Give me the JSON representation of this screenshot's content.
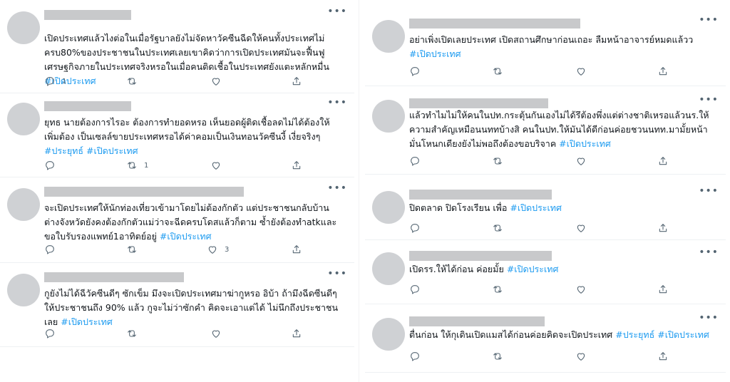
{
  "more_label": "•••",
  "tweets": [
    {
      "body": "เปิดประเทศแล้วไงต่อในเมื่อรัฐบาลยังไม่จัดหาวัคซีนฉีดให้คนทั้งประเทศไม่ครบ80%ของประชาชนในประเทศเลยเขาคิดว่าการเปิดประเทศมันจะฟื้นฟูเศรษฐกิจภายในประเทศจริงหรอในเมื่อคนติดเชื้อในประเทศยังแตะหลักหมื่น",
      "tags": "#เปิดประเทศ",
      "reply": "1",
      "retweet": "",
      "like": ""
    },
    {
      "body": "ยุทธ นายต้องการไรอะ ต้องการทำยอดหรอ  เห็นยอดผู้ติดเชื้อลดไม่ได้ต้องให้เพิ่มต้อง เป็นเซลล์ขายประเทศหรอได้ค่าคอมเป็นเงินทอนวัคซีนงี้ เงี่ยจริงๆ",
      "tags": "#ประยุทธ์ #เปิดประเทศ",
      "reply": "",
      "retweet": "1",
      "like": ""
    },
    {
      "body": "จะเปิดประเทศให้นักท่องเที่ยวเข้ามาโดยไม่ต้องกักตัว แต่ประชาชนกลับบ้านต่างจังหวัดยังคงต้องกักตัวแม่ว่าจะฉีดครบโดสแล้วก็ตาม ซ้ำยังต้องทำatkและขอใบรับรองแพทย์1อาทิตย์อยู่",
      "tags": "#เปิดประเทศ",
      "reply": "",
      "retweet": "",
      "like": "3"
    },
    {
      "body": "กูยังไม่ได้ฉีวัคซีนดีๆ ซักเข็ม มึงจะเปิดประเทศมาฆ่ากูหรอ อิบ้า ถ้ามึงฉีดซีนดีๆ ให้ประชาชนถึง 90% แล้ว กูจะไม่ว่าซักคำ คิดจะเอาแต่ได้ ไม่นึกถึงประชาชนเลย",
      "tags": "#เปิดประเทศ",
      "reply": "",
      "retweet": "",
      "like": ""
    },
    {
      "body": "อย่าเพิ่งเปิดเลยประเทศ เปิดสถานศึกษาก่อนเถอะ ลืมหน้าอาจารย์หมดแล้วว",
      "tags": "#เปิดประเทศ",
      "reply": "",
      "retweet": "",
      "like": ""
    },
    {
      "body": "แล้วทำไมไม่ให้คนในปท.กระตุ้นกันเองไม่ได้รึต้องพึ่งแต่ต่างชาติเหรอแล้วนร.ให้ความสำคัญเหมือนนททบ้างสิ คนในปท.ให้มันได้ดีก่อนค่อยชวนนทท.มามั้ยหน้ามั่นโหนกเดียงยังไม่พอถึงต้องขอบริจาค",
      "tags": "#เปิดประเทศ",
      "reply": "",
      "retweet": "",
      "like": ""
    },
    {
      "body": "ปิดตลาด ปิดโรงเรียน เพื่อ",
      "tags": "#เปิดประเทศ",
      "reply": "",
      "retweet": "",
      "like": ""
    },
    {
      "body": "เปิดรร.ให้ได้ก่อน ค่อยมั้ย",
      "tags": "#เปิดประเทศ",
      "reply": "",
      "retweet": "",
      "like": ""
    },
    {
      "body": "ตื่นก่อน ให้กุเดินเปิดแมสได้ก่อนค่อยคิดจะเปิดประเทศ",
      "tags": "#ประยุทธ์ #เปิดประเทศ",
      "reply": "",
      "retweet": "",
      "like": ""
    }
  ]
}
